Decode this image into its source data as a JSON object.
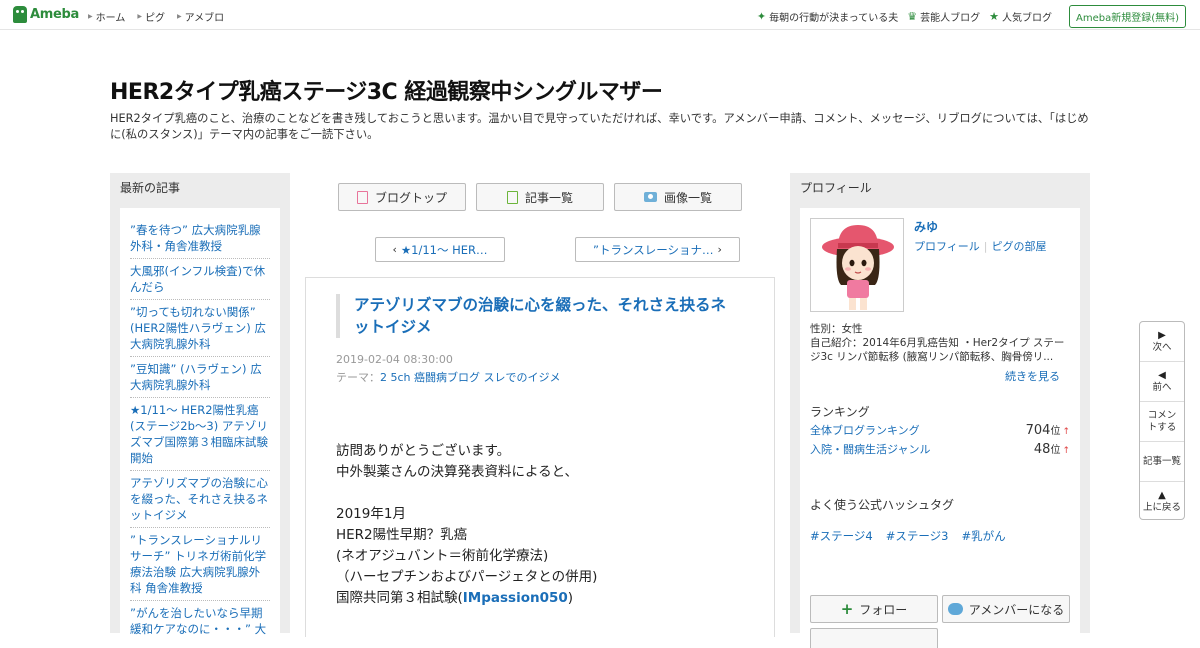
{
  "global_nav": {
    "logo": "Ameba",
    "links": [
      "ホーム",
      "ピグ",
      "アメブロ"
    ],
    "right_links": [
      {
        "label": "毎朝の行動が決まっている夫",
        "icon": "sparkle-icon"
      },
      {
        "label": "芸能人ブログ",
        "icon": "crown-icon"
      },
      {
        "label": "人気ブログ",
        "icon": "star-icon"
      }
    ],
    "register": "Ameba新規登録(無料)"
  },
  "blog": {
    "title": "HER2タイプ乳癌ステージ3C 経過観察中シングルマザー",
    "description": "HER2タイプ乳癌のこと、治療のことなどを書き残しておこうと思います。温かい目で見守っていただければ、幸いです。アメンバー申請、コメント、メッセージ、リブログについては、「はじめに(私のスタンス)」テーマ内の記事をご一読下さい。"
  },
  "left": {
    "heading": "最新の記事",
    "recent": [
      "”春を待つ” 広大病院乳腺外科・角舎准教授",
      "大風邪(インフル検査)で休んだら",
      "”切っても切れない関係” (HER2陽性ハラヴェン) 広大病院乳腺外科",
      "”豆知識” (ハラヴェン) 広大病院乳腺外科",
      "★1/11～ HER2陽性乳癌(ステージ2b～3) アテゾリズマブ国際第３相臨床試験開始",
      "アテゾリズマブの治験に心を綴った、それさえ抉るネットイジメ",
      "”トランスレーショナルリサーチ” トリネガ術前化学療法治験 広大病院乳腺外科 角舎准教授",
      "”がんを治したいなら早期緩和ケアなのに・・・” 大津秀一緩和医"
    ]
  },
  "center": {
    "tabs": [
      "ブログトップ",
      "記事一覧",
      "画像一覧"
    ],
    "prev": "★1/11～ HER…",
    "next": "”トランスレーショナ…",
    "article": {
      "title": "アテゾリズマブの治験に心を綴った、それさえ抉るネットイジメ",
      "date": "2019-02-04 08:30:00",
      "theme_label": "テーマ：",
      "theme": "2 5ch 癌闘病ブログ スレでのイジメ",
      "body": [
        "訪問ありがとうございます。",
        "中外製薬さんの決算発表資料によると、",
        "",
        "2019年1月",
        "HER2陽性早期？乳癌",
        "(ネオアジュバント＝術前化学療法)",
        "（ハーセプチンおよびパージェタとの併用)"
      ],
      "last_line_prefix": "国際共同第３相試験(",
      "last_line_bold": "IMpassion050",
      "last_line_suffix": ")"
    }
  },
  "right": {
    "heading": "プロフィール",
    "name": "みゆ",
    "link_profile": "プロフィール",
    "link_pig": "ピグの部屋",
    "gender": "性別：女性",
    "intro": "自己紹介：2014年6月乳癌告知 ・Her2タイプ ステージ3c リンパ節転移 (腋窩リンパ節転移、胸骨傍リ...",
    "more": "続きを見る",
    "ranking_heading": "ランキング",
    "rankings": [
      {
        "label": "全体ブログランキング",
        "value": "704",
        "unit": "位",
        "arrow": "↑"
      },
      {
        "label": "入院・闘病生活ジャンル",
        "value": "48",
        "unit": "位",
        "arrow": "↑"
      }
    ],
    "hashtag_heading": "よく使う公式ハッシュタグ",
    "hashtags": [
      "#ステージ4",
      "#ステージ3",
      "#乳がん"
    ],
    "follow": "フォロー",
    "member": "アメンバーになる"
  },
  "sidenav": [
    {
      "label": "次へ",
      "icon": "play-right-icon"
    },
    {
      "label": "前へ",
      "icon": "play-left-icon"
    },
    {
      "label": "コメントする",
      "icon": ""
    },
    {
      "label": "記事一覧",
      "icon": ""
    },
    {
      "label": "上に戻る",
      "icon": "arrow-up-icon"
    }
  ]
}
